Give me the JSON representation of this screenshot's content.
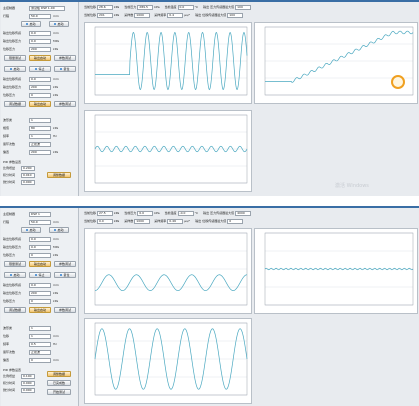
{
  "window1": {
    "left_fields": [
      {
        "label": "主控制器",
        "value": "测试板 DSP 1.00",
        "unit": ""
      },
      {
        "label": "行程",
        "value": "50.0",
        "unit": "mm"
      }
    ],
    "toggle_buttons": [
      "启动",
      "启动"
    ],
    "sensor_fields": [
      {
        "label": "输出位移传感",
        "value": "0.0",
        "unit": "mm"
      },
      {
        "label": "输出位移压力",
        "value": "0.0",
        "unit": "MPa"
      },
      {
        "label": "位移压力",
        "value": "200",
        "unit": "kPa"
      }
    ],
    "button_row1": [
      "限量测试",
      "输出启动",
      "参数调试"
    ],
    "button_row2": [
      "启动",
      "停止",
      "复位"
    ],
    "sensor_fields2": [
      {
        "label": "输出位移传感",
        "value": "0.0",
        "unit": "mm"
      },
      {
        "label": "输出位移压力",
        "value": "200",
        "unit": "kPa"
      },
      {
        "label": "位移压力",
        "value": "0",
        "unit": "kPa"
      }
    ],
    "button_row3": [
      "调试数据",
      "输出启动",
      "参数调试"
    ],
    "wave_fields": [
      {
        "label": "波形类",
        "value": "1",
        "unit": ""
      },
      {
        "label": "幅值",
        "value": "80",
        "unit": "kPa"
      },
      {
        "label": "频率",
        "value": "1",
        "unit": "Hz"
      },
      {
        "label": "循环次数",
        "value": "正弦波",
        "unit": ""
      },
      {
        "label": "偏置",
        "value": "200",
        "unit": "kPa"
      }
    ],
    "pid_title": "PID 参数设置",
    "pid_fields": [
      {
        "label": "比例增益",
        "value": "0.200"
      },
      {
        "label": "积分时间",
        "value": "0.010"
      },
      {
        "label": "微分时间",
        "value": "0.000"
      }
    ],
    "pid_button": "调整数据",
    "params_row1": [
      {
        "label": "当前位移",
        "value": "28.6",
        "unit": "kPa"
      },
      {
        "label": "当前压力",
        "value": "289.5",
        "unit": "kPa"
      },
      {
        "label": "当前温度",
        "value": "0.0",
        "unit": "°C"
      },
      {
        "label": "输出 压力传感器最大值",
        "value": "100"
      }
    ],
    "params_row2": [
      {
        "label": "当前位移",
        "value": "201",
        "unit": "kPa"
      },
      {
        "label": "采样数",
        "value": "1000",
        "unit": ""
      },
      {
        "label": "采样频率",
        "value": "0.4",
        "unit": "μs/°"
      },
      {
        "label": "输出 位移传感器最大值",
        "value": "100"
      }
    ],
    "watermark": "激活 Windows"
  },
  "window2": {
    "left_fields": [
      {
        "label": "主控制器",
        "value": "DSP 1",
        "unit": ""
      },
      {
        "label": "行程",
        "value": "50.0",
        "unit": "mm"
      }
    ],
    "toggle_buttons": [
      "启动",
      "启动"
    ],
    "sensor_fields": [
      {
        "label": "输出位移传感",
        "value": "0.0",
        "unit": "mm"
      },
      {
        "label": "输出位移压力",
        "value": "0.0",
        "unit": "MPa"
      },
      {
        "label": "位移压力",
        "value": "0",
        "unit": "kPa"
      }
    ],
    "button_row1": [
      "限量测试",
      "输出启动",
      "参数调试"
    ],
    "button_row2": [
      "启动",
      "停止",
      "复位"
    ],
    "sensor_fields2": [
      {
        "label": "输出位移传感",
        "value": "0.0",
        "unit": "mm"
      },
      {
        "label": "输出位移压力",
        "value": "200",
        "unit": "kPa"
      },
      {
        "label": "位移压力",
        "value": "0",
        "unit": "kPa"
      }
    ],
    "button_row3": [
      "调试数据",
      "输出启动",
      "参数调试"
    ],
    "wave_fields": [
      {
        "label": "波形类",
        "value": "1",
        "unit": ""
      },
      {
        "label": "位移",
        "value": "1",
        "unit": "mm"
      },
      {
        "label": "频率",
        "value": "0.5",
        "unit": "Hz"
      },
      {
        "label": "循环次数",
        "value": "正弦波",
        "unit": ""
      },
      {
        "label": "偏置",
        "value": "0",
        "unit": "mm"
      }
    ],
    "pid_title": "PID 参数设置",
    "pid_fields": [
      {
        "label": "比例增益",
        "value": "0.100"
      },
      {
        "label": "积分时间",
        "value": "0.000"
      },
      {
        "label": "微分时间",
        "value": "0.000"
      }
    ],
    "pid_buttons": [
      "调整数据",
      "已完成数",
      "开始测试"
    ],
    "params_row1": [
      {
        "label": "当前位移",
        "value": "27.5",
        "unit": "kPa"
      },
      {
        "label": "当前压力",
        "value": "0.0",
        "unit": "kPa"
      },
      {
        "label": "当前温度",
        "value": "-0.0",
        "unit": "°C"
      },
      {
        "label": "输出 压力传感器最大值",
        "value": "4000"
      }
    ],
    "params_row2": [
      {
        "label": "当前位移",
        "value": "0.0",
        "unit": "kPa"
      },
      {
        "label": "采样数",
        "value": "1000",
        "unit": ""
      },
      {
        "label": "采样频率",
        "value": "0.46",
        "unit": "μs/°"
      },
      {
        "label": "输出 位移传感器最大值",
        "value": "0"
      }
    ]
  },
  "colors": {
    "trace": "#4aa8c0",
    "grid": "#dfe3e8",
    "panel": "#edf0f3"
  }
}
